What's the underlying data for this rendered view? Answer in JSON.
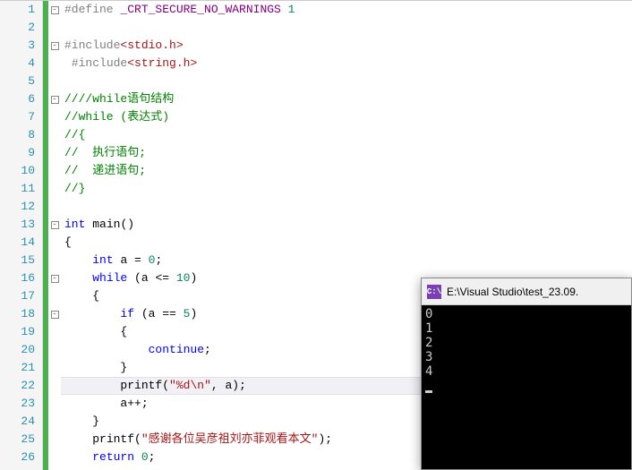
{
  "lines": [
    1,
    2,
    3,
    4,
    5,
    6,
    7,
    8,
    9,
    10,
    11,
    12,
    13,
    14,
    15,
    16,
    17,
    18,
    19,
    20,
    21,
    22,
    23,
    24,
    25,
    26
  ],
  "fold": {
    "l1": "-",
    "l3": "-",
    "l6": "-",
    "l13": "-",
    "l16": "-",
    "l18": "-"
  },
  "code": {
    "l1": {
      "pp": "#define ",
      "macro": "_CRT_SECURE_NO_WARNINGS",
      "num": " 1"
    },
    "l3": {
      "pp": "#include",
      "inc": "<stdio.h>"
    },
    "l4": {
      "pp": "#include",
      "inc": "<string.h>"
    },
    "l6": {
      "cmt": "////while语句结构"
    },
    "l7": {
      "cmt": "//while (表达式)"
    },
    "l8": {
      "cmt": "//{"
    },
    "l9": {
      "cmt": "//  执行语句;"
    },
    "l10": {
      "cmt": "//  递进语句;"
    },
    "l11": {
      "cmt": "//}"
    },
    "l13": {
      "kw1": "int ",
      "id": "main",
      "p": "()"
    },
    "l14": {
      "p": "{"
    },
    "l15": {
      "kw1": "int ",
      "id": "a ",
      "op": "= ",
      "num": "0",
      "sc": ";"
    },
    "l16": {
      "kw1": "while ",
      "p1": "(a ",
      "op": "<= ",
      "num": "10",
      "p2": ")"
    },
    "l17": {
      "p": "{"
    },
    "l18": {
      "kw1": "if ",
      "p1": "(a ",
      "op": "== ",
      "num": "5",
      "p2": ")"
    },
    "l19": {
      "p": "{"
    },
    "l20": {
      "kw1": "continue",
      "sc": ";"
    },
    "l21": {
      "p": "}"
    },
    "l22": {
      "id": "printf",
      "p1": "(",
      "str": "\"%d",
      "esc": "\\n",
      "str2": "\"",
      "p2": ", a);"
    },
    "l23": {
      "id": "a",
      "op": "++",
      "sc": ";"
    },
    "l24": {
      "p": "}"
    },
    "l25": {
      "id": "printf",
      "p1": "(",
      "str": "\"感谢各位吴彦祖刘亦菲观看本文\"",
      "p2": ");"
    },
    "l26": {
      "kw1": "return ",
      "num": "0",
      "sc": ";"
    }
  },
  "console": {
    "title": "E:\\Visual Studio\\test_23.09.",
    "output": [
      "0",
      "1",
      "2",
      "3",
      "4"
    ]
  }
}
